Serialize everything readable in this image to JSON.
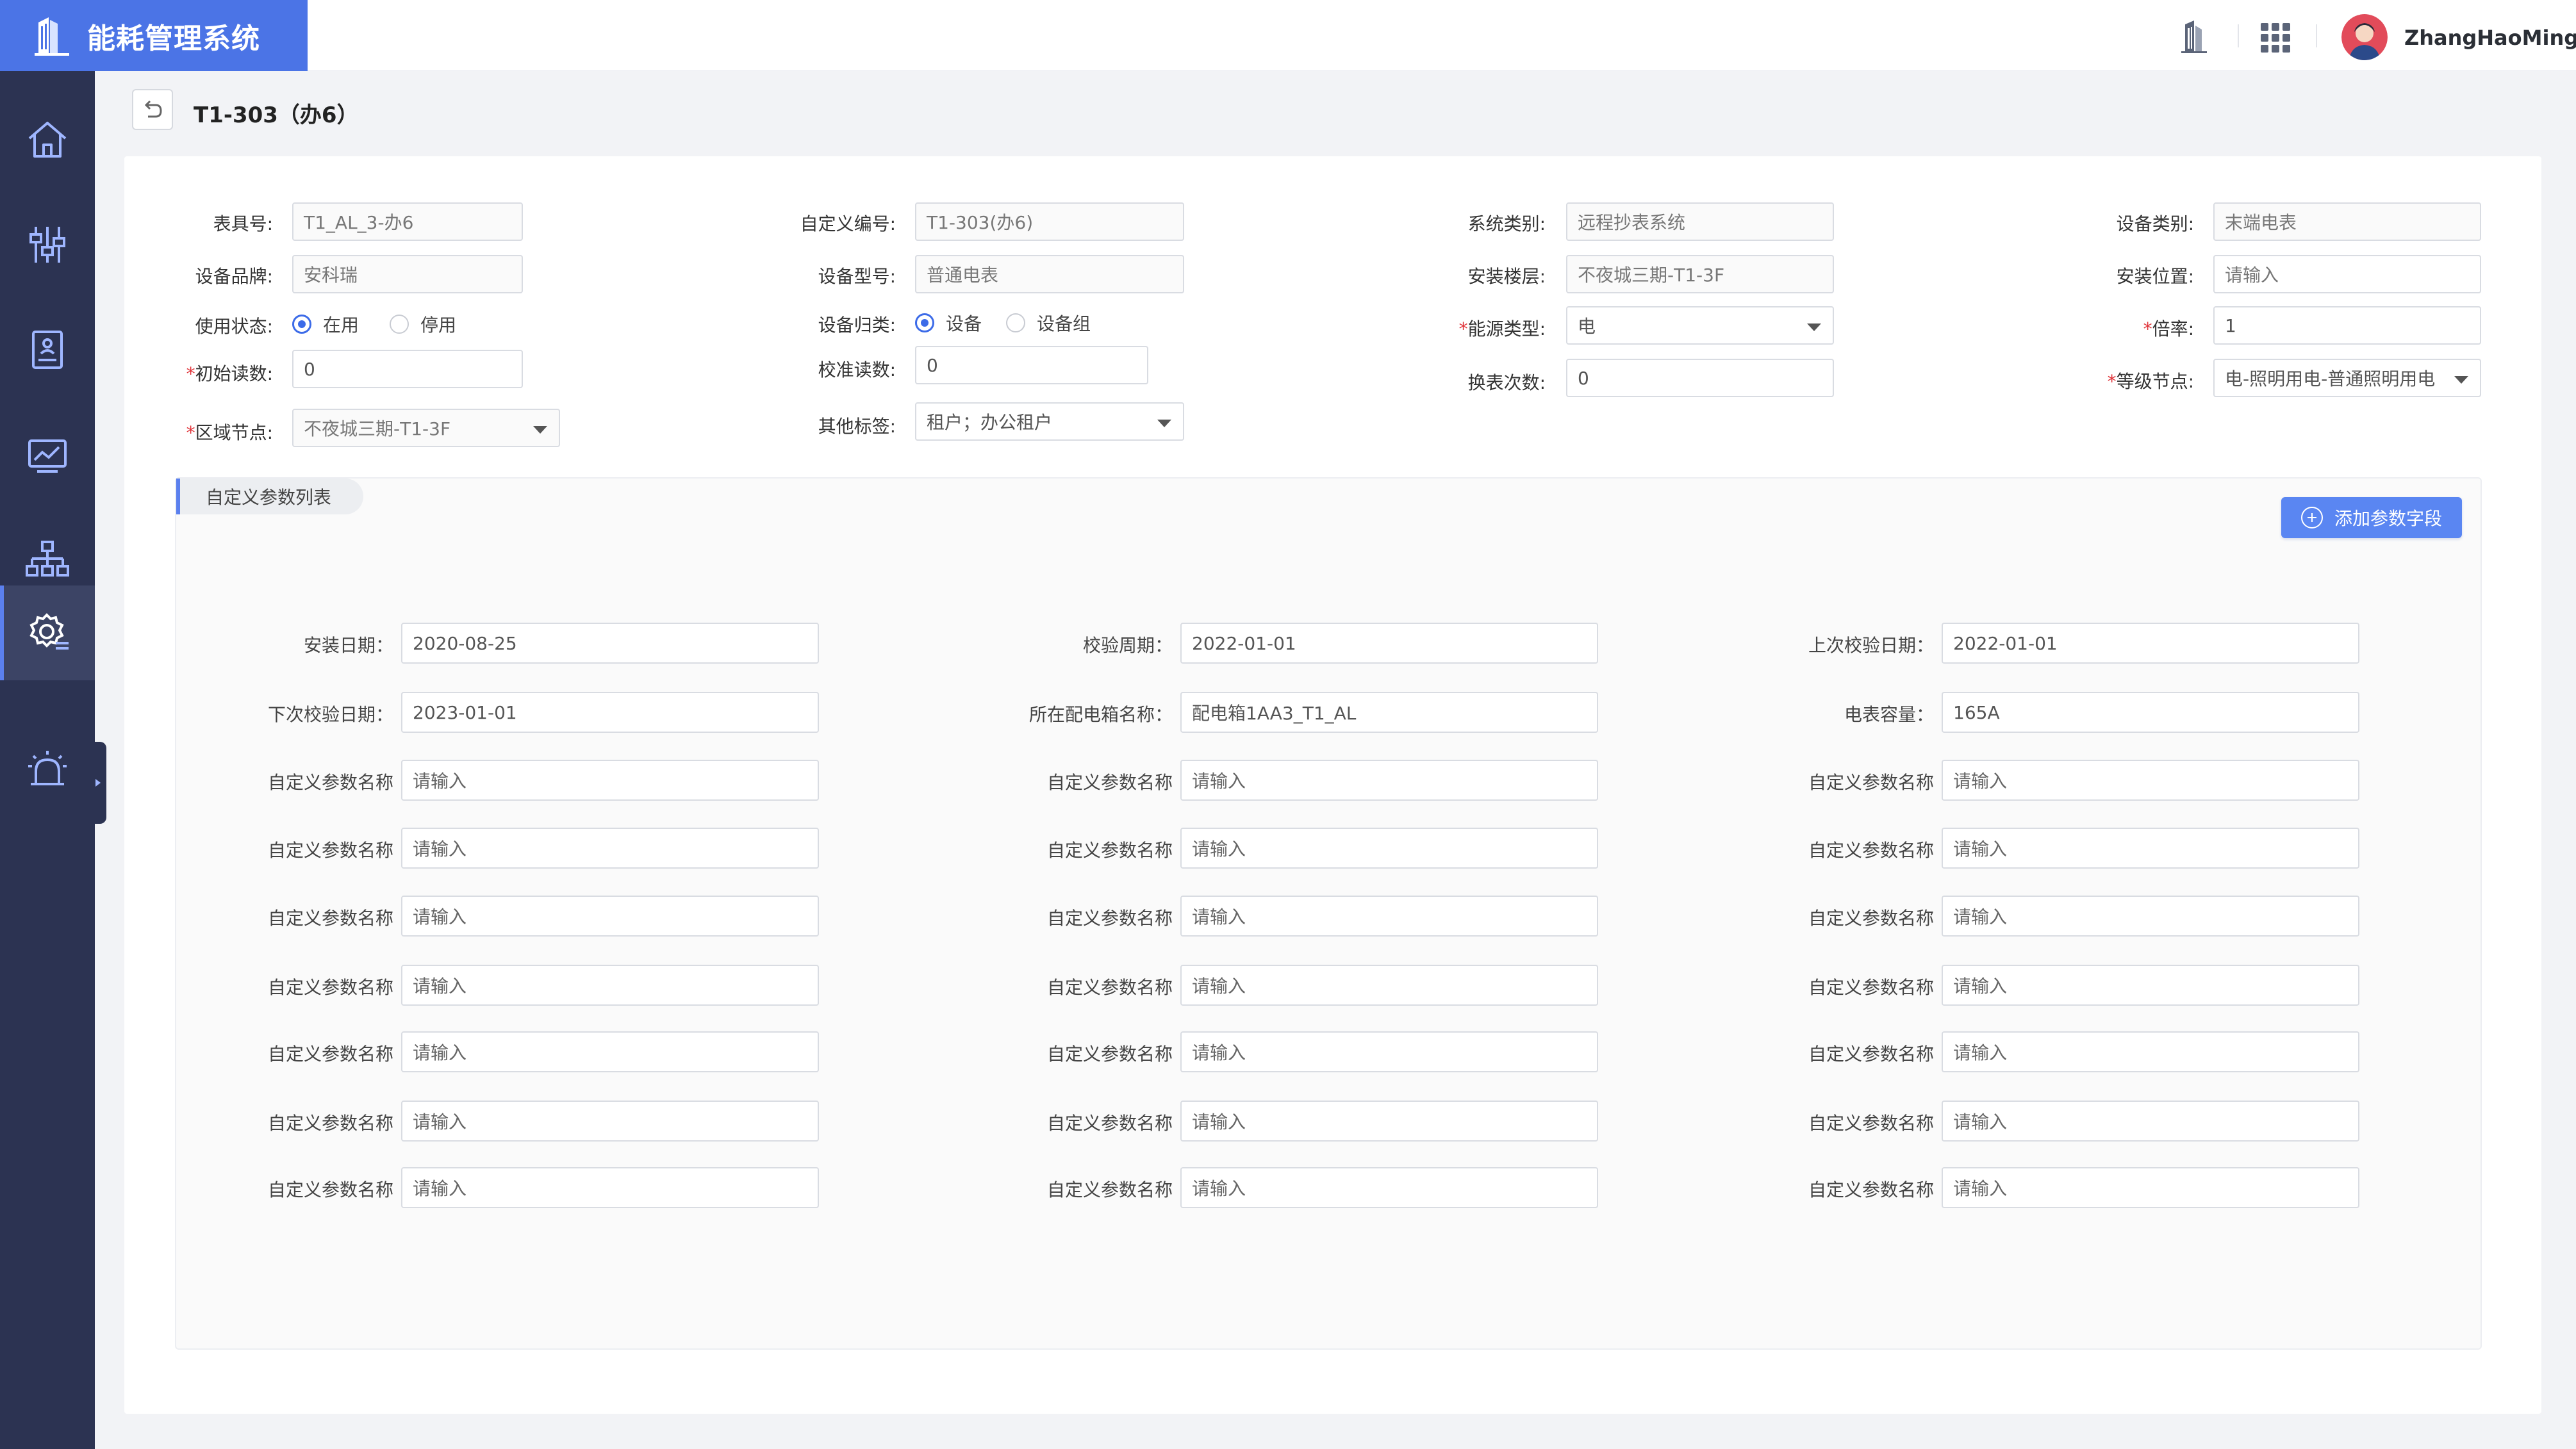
{
  "app": {
    "title": "能耗管理系统"
  },
  "header": {
    "username": "ZhangHaoMing"
  },
  "page": {
    "title": "T1-303（办6）"
  },
  "form": {
    "meter_no": {
      "label": "表具号:",
      "value": "T1_AL_3-办6"
    },
    "custom_no": {
      "label": "自定义编号:",
      "value": "T1-303(办6)"
    },
    "system_type": {
      "label": "系统类别:",
      "value": "远程抄表系统"
    },
    "device_category": {
      "label": "设备类别:",
      "value": "末端电表"
    },
    "brand": {
      "label": "设备品牌:",
      "value": "安科瑞"
    },
    "model": {
      "label": "设备型号:",
      "value": "普通电表"
    },
    "install_floor": {
      "label": "安装楼层:",
      "value": "不夜城三期-T1-3F"
    },
    "install_location": {
      "label": "安装位置:",
      "placeholder": "请输入"
    },
    "usage_status": {
      "label": "使用状态:",
      "options": [
        "在用",
        "停用"
      ],
      "selected": "在用"
    },
    "device_group": {
      "label": "设备归类:",
      "options": [
        "设备",
        "设备组"
      ],
      "selected": "设备"
    },
    "energy_type": {
      "label": "能源类型:",
      "value": "电"
    },
    "ratio": {
      "label": "倍率:",
      "value": "1"
    },
    "initial_reading": {
      "label": "初始读数:",
      "value": "0"
    },
    "calib_reading": {
      "label": "校准读数:",
      "value": "0"
    },
    "replace_count": {
      "label": "换表次数:",
      "value": "0"
    },
    "level_node": {
      "label": "等级节点:",
      "value": "电-照明用电-普通照明用电"
    },
    "area_node": {
      "label": "区域节点:",
      "value": "不夜城三期-T1-3F"
    },
    "other_tags": {
      "label": "其他标签:",
      "value": "租户；办公租户"
    }
  },
  "params": {
    "section_title": "自定义参数列表",
    "add_label": "添加参数字段",
    "fixed": [
      {
        "label": "安装日期：",
        "value": "2020-08-25"
      },
      {
        "label": "校验周期：",
        "value": "2022-01-01"
      },
      {
        "label": "上次校验日期：",
        "value": "2022-01-01"
      },
      {
        "label": "下次校验日期：",
        "value": "2023-01-01"
      },
      {
        "label": "所在配电箱名称：",
        "value": "配电箱1AA3_T1_AL"
      },
      {
        "label": "电表容量：",
        "value": "165A"
      }
    ],
    "custom_label": "自定义参数名称",
    "custom_placeholder": "请输入"
  }
}
